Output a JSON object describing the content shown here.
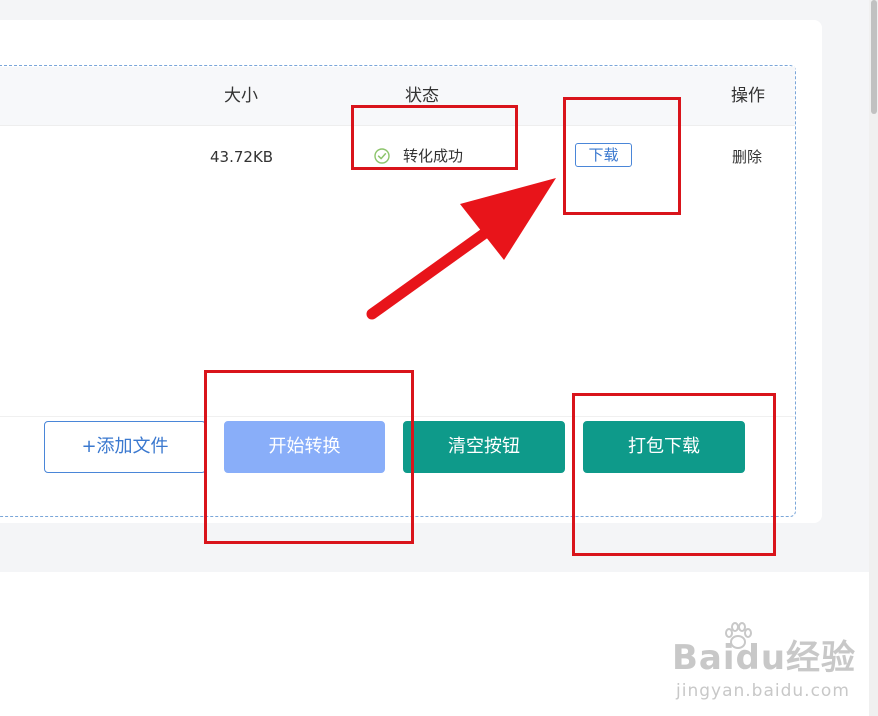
{
  "table": {
    "headers": {
      "size": "大小",
      "status": "状态",
      "action": "操作"
    },
    "rows": [
      {
        "size": "43.72KB",
        "status": "转化成功",
        "download": "下载",
        "delete": "删除"
      }
    ]
  },
  "footer": {
    "add_files": "+添加文件",
    "start_convert": "开始转换",
    "clear": "清空按钮",
    "pack_download": "打包下载"
  },
  "watermark": {
    "main": "Baidu经验",
    "sub": "jingyan.baidu.com"
  },
  "colors": {
    "accent_blue": "#3a78cf",
    "start_button": "#89aef9",
    "teal_button": "#0e9a8a",
    "success_icon": "#8cc46b",
    "annotation_red": "#d9141b"
  },
  "icons": {
    "status_success": "check-circle-icon",
    "watermark": "paw-icon"
  }
}
